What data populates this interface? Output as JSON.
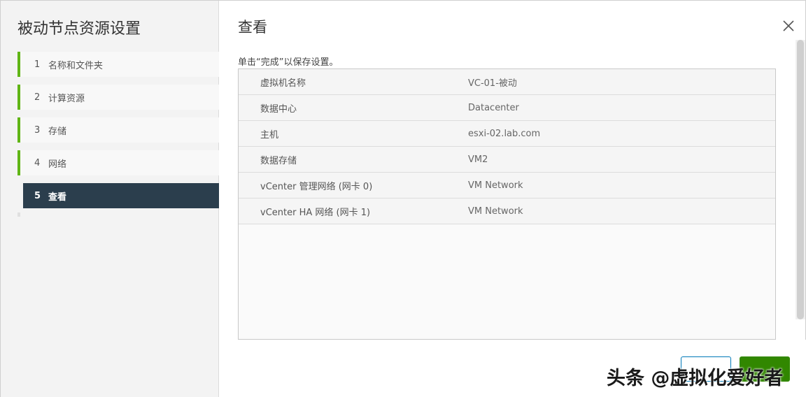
{
  "nav": {
    "title": "被动节点资源设置",
    "steps": [
      {
        "num": "1",
        "label": "名称和文件夹"
      },
      {
        "num": "2",
        "label": "计算资源"
      },
      {
        "num": "3",
        "label": "存储"
      },
      {
        "num": "4",
        "label": "网络"
      },
      {
        "num": "5",
        "label": "查看"
      }
    ]
  },
  "main": {
    "title": "查看",
    "instruction": "单击“完成”以保存设置。",
    "rows": [
      {
        "key": "虚拟机名称",
        "value": "VC-01-被动"
      },
      {
        "key": "数据中心",
        "value": "Datacenter"
      },
      {
        "key": "主机",
        "value": "esxi-02.lab.com"
      },
      {
        "key": "数据存储",
        "value": "VM2"
      },
      {
        "key": "vCenter 管理网络 (网卡 0)",
        "value": "VM Network"
      },
      {
        "key": "vCenter HA 网络 (网卡 1)",
        "value": "VM Network"
      }
    ]
  },
  "footer": {
    "cancel_label": "",
    "finish_label": ""
  },
  "watermark": "头条 @虚拟化爱好者",
  "colors": {
    "accent_green": "#60b515",
    "active_step_bg": "#2b3e4d",
    "primary_button": "#318700",
    "link_blue": "#0079b8"
  },
  "icons": {
    "close": "close-icon"
  }
}
